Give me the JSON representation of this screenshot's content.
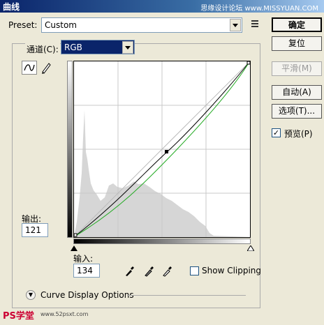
{
  "window": {
    "title": "曲线",
    "watermark_top": "思缘设计论坛 www.MISSYUAN.COM"
  },
  "preset": {
    "label": "Preset:",
    "value": "Custom"
  },
  "buttons": {
    "ok": "确定",
    "reset": "复位",
    "smooth": "平滑(M)",
    "auto": "自动(A)",
    "options": "选项(T)..."
  },
  "preview": {
    "label": "预览(P)",
    "checked": "✓"
  },
  "channel": {
    "label": "通道(C):",
    "value": "RGB"
  },
  "output": {
    "label": "输出:",
    "value": "121"
  },
  "input": {
    "label": "输入:",
    "value": "134"
  },
  "show_clipping": {
    "label": "Show Clipping"
  },
  "curve_display": {
    "label": "Curve Display Options"
  },
  "watermark_bottom": {
    "logo": "PS学堂",
    "url": "www.52psxt.com"
  },
  "colors": {
    "accent": "#0a246a",
    "curve_green": "#22aa22",
    "histogram": "#d8d8d8"
  }
}
